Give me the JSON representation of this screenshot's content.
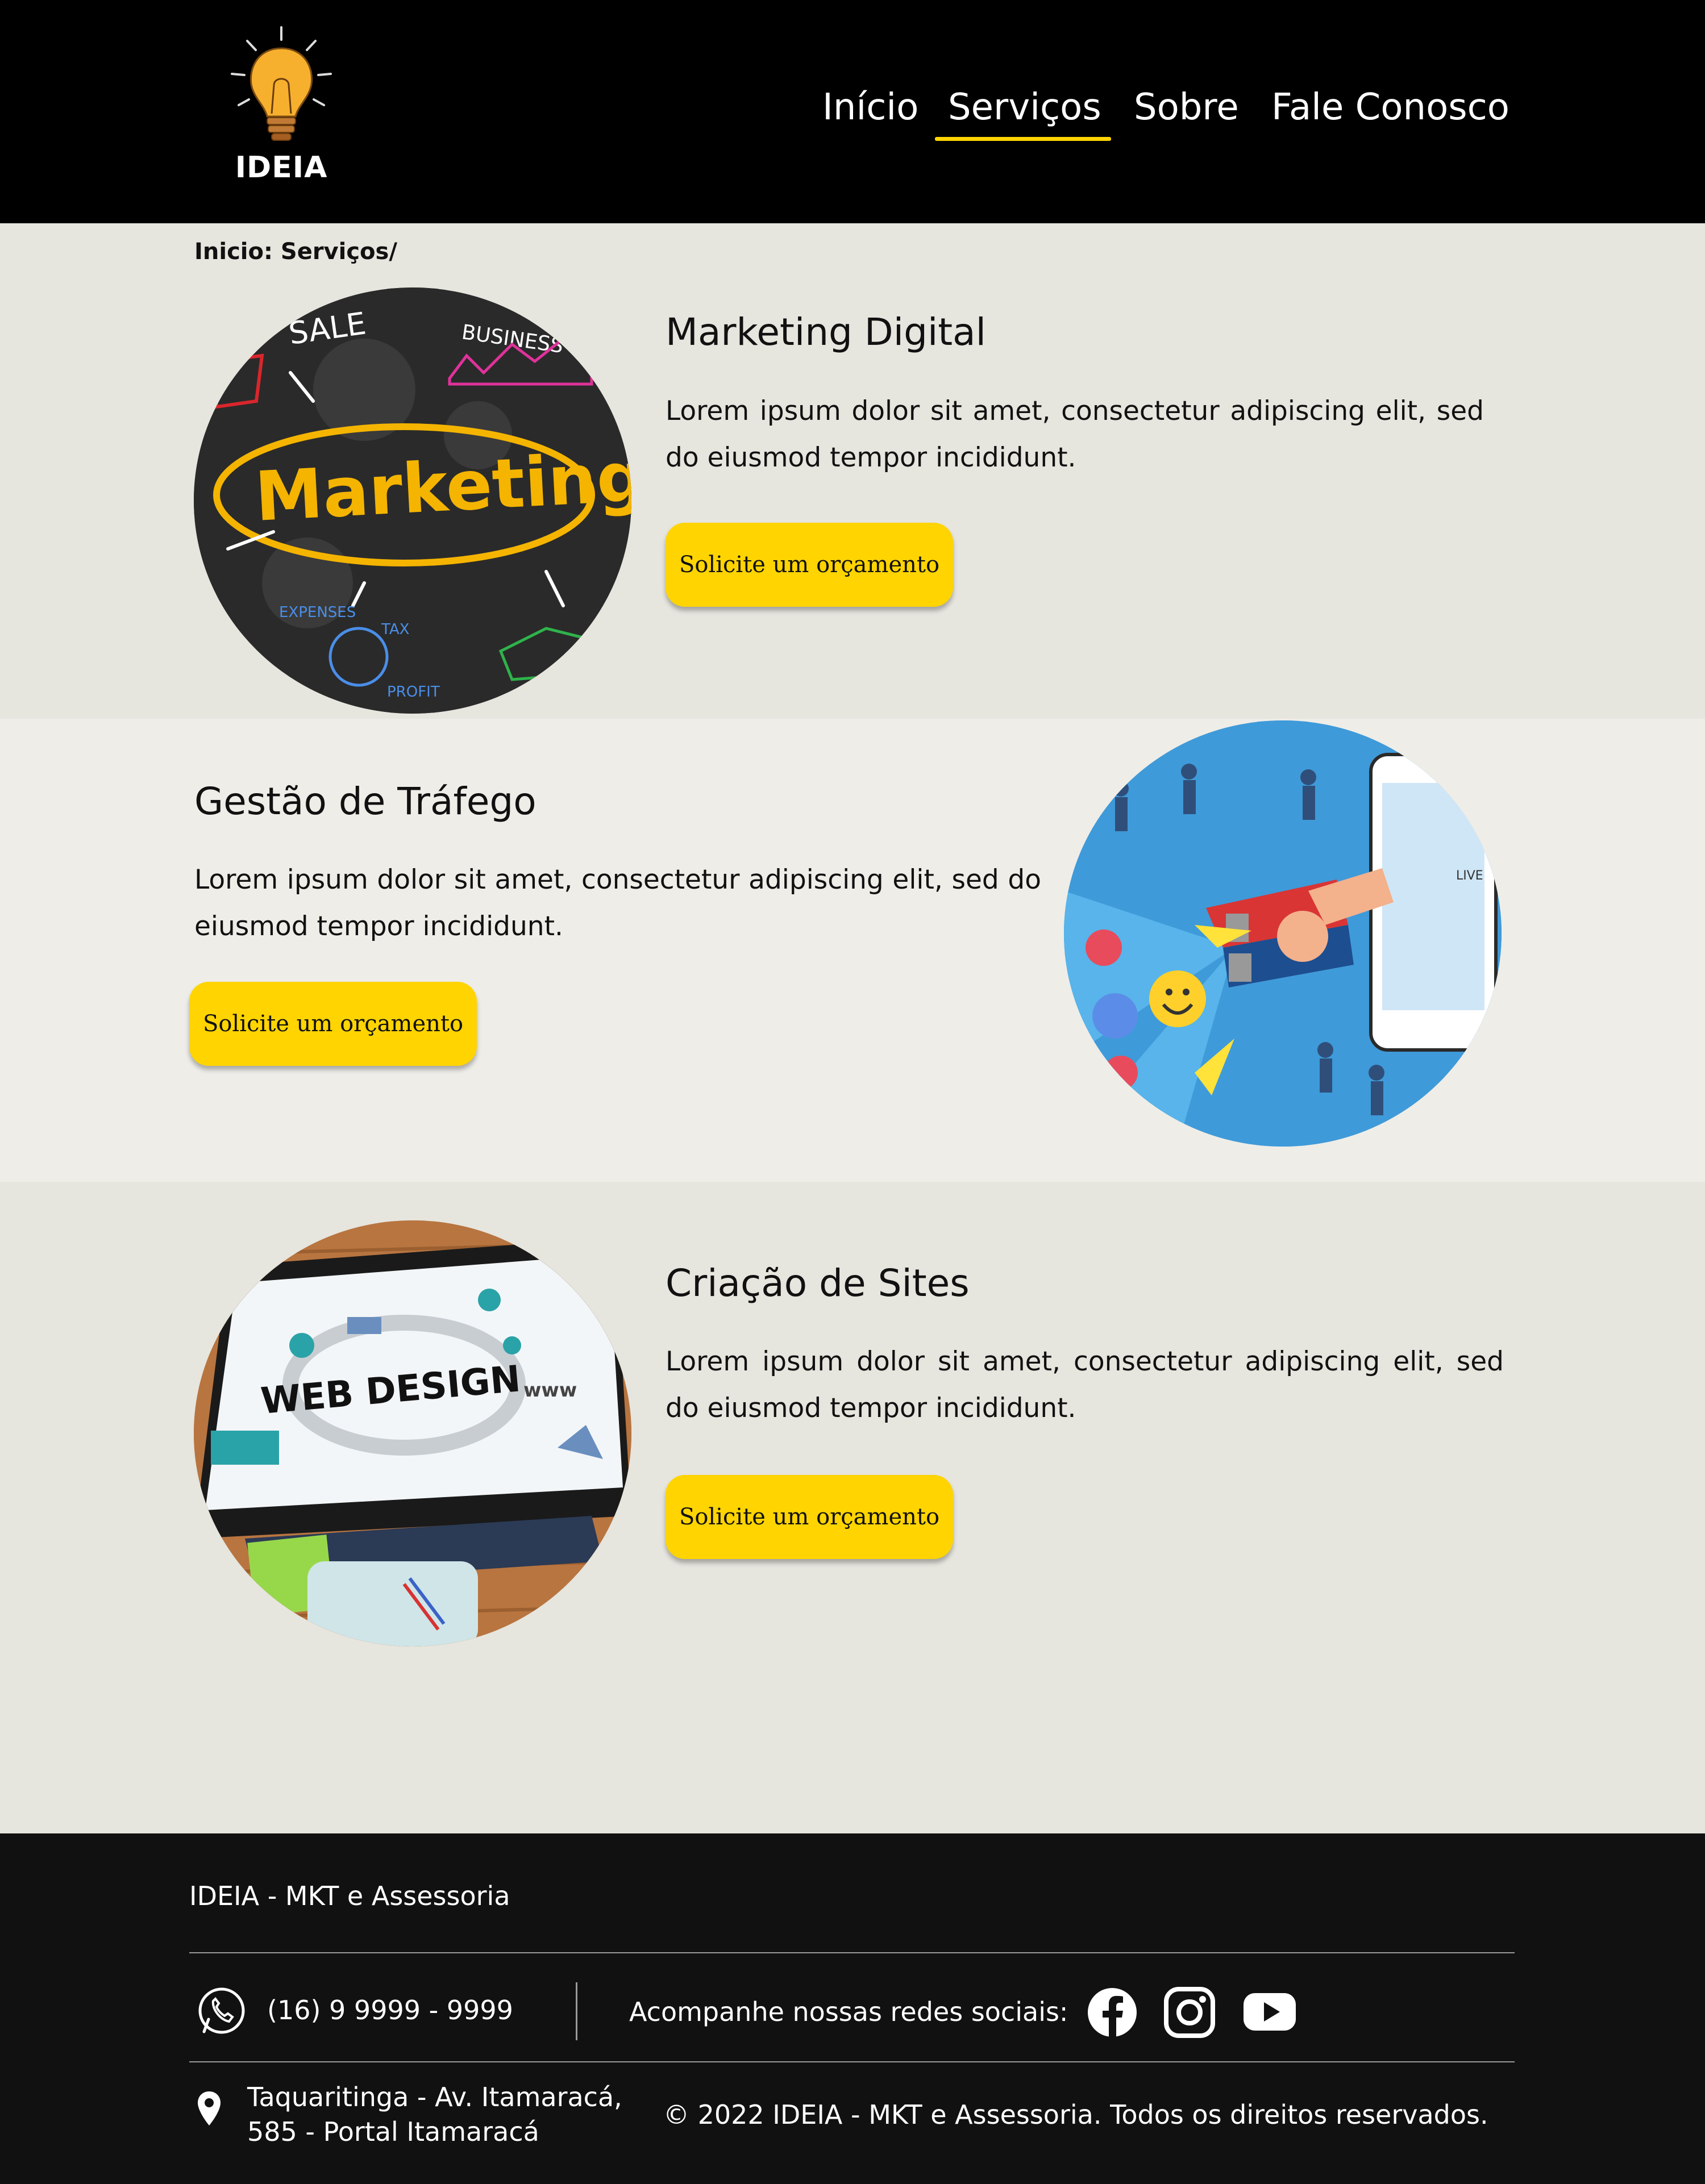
{
  "header": {
    "logo_text": "IDEIA",
    "nav": [
      {
        "label": "Início"
      },
      {
        "label": "Serviços"
      },
      {
        "label": "Sobre"
      },
      {
        "label": "Fale Conosco"
      }
    ],
    "active_nav": "Serviços",
    "accent_color": "#ffd500"
  },
  "breadcrumb": "Inicio: Serviços/",
  "services": [
    {
      "title": "Marketing Digital",
      "description": "Lorem ipsum dolor sit amet, consectetur adipiscing elit, sed do eiusmod tempor incididunt.",
      "cta": "Solicite um orçamento",
      "image_icon": "marketing-chalkboard-image"
    },
    {
      "title": "Gestão de Tráfego",
      "description": "Lorem ipsum dolor sit amet, consectetur adipiscing elit, sed do eiusmod tempor incididunt.",
      "cta": "Solicite um orçamento",
      "image_icon": "magnet-social-media-image"
    },
    {
      "title": "Criação de Sites",
      "description": "Lorem ipsum dolor sit amet, consectetur adipiscing elit, sed do eiusmod tempor incididunt.",
      "cta": "Solicite um orçamento",
      "image_icon": "web-design-monitor-image",
      "image_text": "WEB DESIGN"
    }
  ],
  "footer": {
    "brand": "IDEIA - MKT e Assessoria",
    "phone": "(16) 9 9999 - 9999",
    "social_label": "Acompanhe nossas redes sociais:",
    "social_icons": [
      "facebook-icon",
      "instagram-icon",
      "youtube-icon"
    ],
    "address_line1": "Taquaritinga - Av. Itamaracá,",
    "address_line2": "585 - Portal Itamaracá",
    "copyright": "© 2022 IDEIA - MKT e Assessoria. Todos os direitos reservados."
  },
  "colors": {
    "header_bg": "#000000",
    "page_bg": "#e6e5de",
    "button": "#ffd400",
    "footer_bg": "#111111"
  }
}
